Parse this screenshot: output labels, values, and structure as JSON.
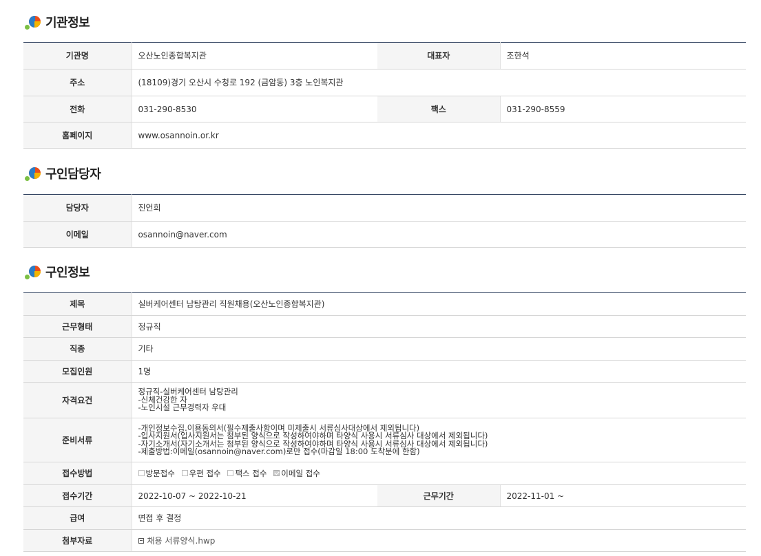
{
  "sections": {
    "agency": {
      "title": "기관정보"
    },
    "contact": {
      "title": "구인담당자"
    },
    "job": {
      "title": "구인정보"
    }
  },
  "agency": {
    "name_label": "기관명",
    "name": "오산노인종합복지관",
    "rep_label": "대표자",
    "rep": "조한석",
    "address_label": "주소",
    "address": "(18109)경기 오산시 수청로 192 (금암동) 3층 노인복지관",
    "phone_label": "전화",
    "phone": "031-290-8530",
    "fax_label": "팩스",
    "fax": "031-290-8559",
    "homepage_label": "홈페이지",
    "homepage": "www.osannoin.or.kr"
  },
  "contact": {
    "person_label": "담당자",
    "person": "진언희",
    "email_label": "이메일",
    "email": "osannoin@naver.com"
  },
  "job": {
    "title_label": "제목",
    "title": "실버케어센터 남탕관리 직원채용(오산노인종합복지관)",
    "type_label": "근무형태",
    "type": "정규직",
    "category_label": "직종",
    "category": "기타",
    "count_label": "모집인원",
    "count": "1명",
    "qual_label": "자격요건",
    "qual": [
      "정규직-실버케어센터 남탕관리",
      "-신체건강한 자",
      "-노인시설 근무경력자 우대"
    ],
    "docs_label": "준비서류",
    "docs": [
      "-개인정보수집.이용동의서(필수제출사항이며 미제출시 서류심사대상에서 제외됩니다)",
      "-입사지원서(입사지원서는 첨부된 양식으로 작성하여야하며 타양식 사용시 서류심사 대상에서 제외됩니다)",
      "-자기소개서(자기소개서는 첨부된 양식으로 작성하여야하며 타양식 사용시 서류심사 대상에서 제외됩니다)",
      "-제출방법:이메일(osannoin@naver.com)로만 접수(마감일 18:00 도착분에 한함)"
    ],
    "method_label": "접수방법",
    "methods": [
      {
        "label": "방문접수",
        "checked": false
      },
      {
        "label": "우편 접수",
        "checked": false
      },
      {
        "label": "팩스 접수",
        "checked": false
      },
      {
        "label": "이메일 접수",
        "checked": true
      }
    ],
    "period_label": "접수기간",
    "period": "2022-10-07 ~ 2022-10-21",
    "work_period_label": "근무기간",
    "work_period": "2022-11-01 ~",
    "salary_label": "급여",
    "salary": "면접 후 결정",
    "attach_label": "첨부자료",
    "attach": "채용 서류양식.hwp"
  }
}
